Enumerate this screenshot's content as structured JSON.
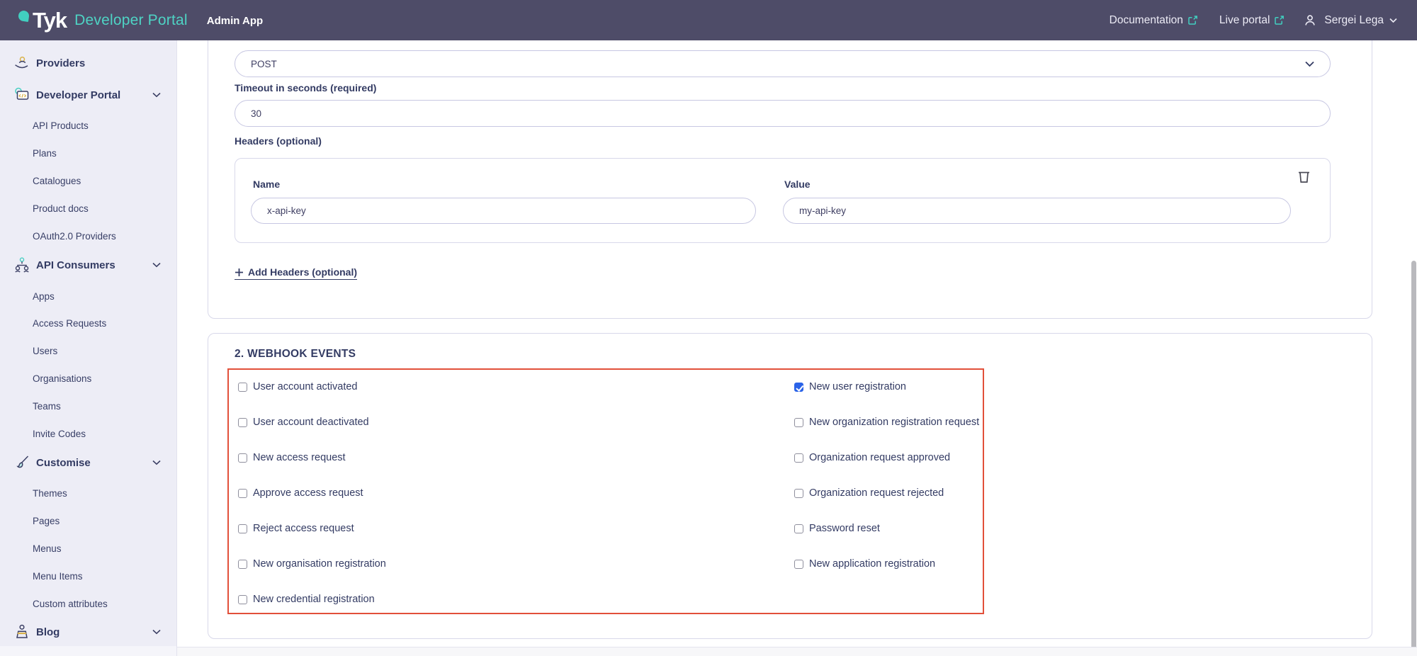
{
  "header": {
    "brand": "Tyk",
    "product": "Developer Portal",
    "app_label": "Admin App",
    "links": [
      {
        "label": "Documentation",
        "icon": "external-link-icon"
      },
      {
        "label": "Live portal",
        "icon": "external-link-icon"
      }
    ],
    "user": {
      "name": "Sergei Lega",
      "icon": "user-icon"
    }
  },
  "sidebar": {
    "items": [
      {
        "label": "Providers",
        "type": "top",
        "icon": "providers-icon",
        "expandable": false
      },
      {
        "label": "Developer Portal",
        "type": "top",
        "icon": "developer-portal-icon",
        "expandable": true
      },
      {
        "label": "API Products",
        "type": "sub"
      },
      {
        "label": "Plans",
        "type": "sub"
      },
      {
        "label": "Catalogues",
        "type": "sub"
      },
      {
        "label": "Product docs",
        "type": "sub"
      },
      {
        "label": "OAuth2.0 Providers",
        "type": "sub"
      },
      {
        "label": "API Consumers",
        "type": "top",
        "icon": "api-consumers-icon",
        "expandable": true
      },
      {
        "label": "Apps",
        "type": "sub"
      },
      {
        "label": "Access Requests",
        "type": "sub"
      },
      {
        "label": "Users",
        "type": "sub"
      },
      {
        "label": "Organisations",
        "type": "sub"
      },
      {
        "label": "Teams",
        "type": "sub"
      },
      {
        "label": "Invite Codes",
        "type": "sub"
      },
      {
        "label": "Customise",
        "type": "top",
        "icon": "customise-icon",
        "expandable": true
      },
      {
        "label": "Themes",
        "type": "sub"
      },
      {
        "label": "Pages",
        "type": "sub"
      },
      {
        "label": "Menus",
        "type": "sub"
      },
      {
        "label": "Menu Items",
        "type": "sub"
      },
      {
        "label": "Custom attributes",
        "type": "sub"
      },
      {
        "label": "Blog",
        "type": "top",
        "icon": "blog-icon",
        "expandable": true
      }
    ]
  },
  "form": {
    "method_value": "POST",
    "timeout_label": "Timeout in seconds (required)",
    "timeout_value": "30",
    "headers_label": "Headers (optional)",
    "header_row": {
      "name_label": "Name",
      "name_value": "x-api-key",
      "value_label": "Value",
      "value_value": "my-api-key",
      "delete_icon": "trash-icon"
    },
    "add_headers_label": "Add Headers (optional)"
  },
  "webhook_events": {
    "title": "2. WEBHOOK EVENTS",
    "left": [
      {
        "label": "User account activated",
        "checked": false
      },
      {
        "label": "User account deactivated",
        "checked": false
      },
      {
        "label": "New access request",
        "checked": false
      },
      {
        "label": "Approve access request",
        "checked": false
      },
      {
        "label": "Reject access request",
        "checked": false
      },
      {
        "label": "New organisation registration",
        "checked": false
      },
      {
        "label": "New credential registration",
        "checked": false
      }
    ],
    "right": [
      {
        "label": "New user registration",
        "checked": true
      },
      {
        "label": "New organization registration request",
        "checked": false
      },
      {
        "label": "Organization request approved",
        "checked": false
      },
      {
        "label": "Organization request rejected",
        "checked": false
      },
      {
        "label": "Password reset",
        "checked": false
      },
      {
        "label": "New application registration",
        "checked": false
      }
    ]
  },
  "colors": {
    "header_bg": "#4e4c68",
    "accent_teal": "#41cfc0",
    "text_navy": "#333b63",
    "highlight_red": "#e2503a",
    "checkbox_checked_blue": "#2a63e8",
    "sidebar_bg": "#ededf6",
    "input_border": "#c7c7e2"
  }
}
